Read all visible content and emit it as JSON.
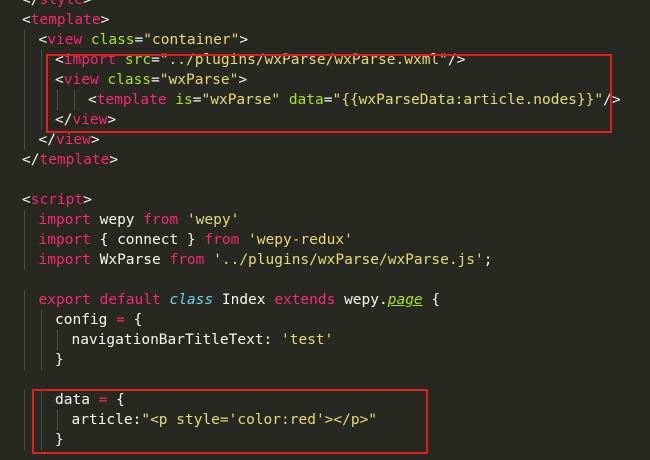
{
  "colors": {
    "background": "#272822",
    "default": "#f8f8f2",
    "tag": "#f92672",
    "attr": "#a6e22e",
    "string": "#e6db74",
    "keyword": "#f92672",
    "storage": "#66d9ef",
    "type": "#a6e22e",
    "annotation": "#e0201b",
    "guide": "#4a4a44"
  },
  "lines": [
    {
      "indent": 0,
      "tokens": [
        {
          "t": "</",
          "c": "default"
        },
        {
          "t": "style",
          "c": "tag"
        },
        {
          "t": ">",
          "c": "default"
        }
      ]
    },
    {
      "indent": 0,
      "tokens": [
        {
          "t": "<",
          "c": "default"
        },
        {
          "t": "template",
          "c": "tag"
        },
        {
          "t": ">",
          "c": "default"
        }
      ]
    },
    {
      "indent": 1,
      "tokens": [
        {
          "t": "<",
          "c": "default"
        },
        {
          "t": "view",
          "c": "tag"
        },
        {
          "t": " ",
          "c": "default"
        },
        {
          "t": "class",
          "c": "attr"
        },
        {
          "t": "=",
          "c": "default"
        },
        {
          "t": "\"container\"",
          "c": "string"
        },
        {
          "t": ">",
          "c": "default"
        }
      ]
    },
    {
      "indent": 2,
      "tokens": [
        {
          "t": "<",
          "c": "default"
        },
        {
          "t": "import",
          "c": "tag"
        },
        {
          "t": " ",
          "c": "default"
        },
        {
          "t": "src",
          "c": "attr"
        },
        {
          "t": "=",
          "c": "default"
        },
        {
          "t": "\"../plugins/wxParse/wxParse.wxml\"",
          "c": "string"
        },
        {
          "t": "/>",
          "c": "default"
        }
      ]
    },
    {
      "indent": 2,
      "tokens": [
        {
          "t": "<",
          "c": "default"
        },
        {
          "t": "view",
          "c": "tag"
        },
        {
          "t": " ",
          "c": "default"
        },
        {
          "t": "class",
          "c": "attr"
        },
        {
          "t": "=",
          "c": "default"
        },
        {
          "t": "\"wxParse\"",
          "c": "string"
        },
        {
          "t": ">",
          "c": "default"
        }
      ]
    },
    {
      "indent": 4,
      "tokens": [
        {
          "t": "<",
          "c": "default"
        },
        {
          "t": "template",
          "c": "tag"
        },
        {
          "t": " ",
          "c": "default"
        },
        {
          "t": "is",
          "c": "attr"
        },
        {
          "t": "=",
          "c": "default"
        },
        {
          "t": "\"wxParse\"",
          "c": "string"
        },
        {
          "t": " ",
          "c": "default"
        },
        {
          "t": "data",
          "c": "attr"
        },
        {
          "t": "=",
          "c": "default"
        },
        {
          "t": "\"{{wxParseData:article.nodes}}\"",
          "c": "string"
        },
        {
          "t": "/>",
          "c": "default"
        }
      ]
    },
    {
      "indent": 2,
      "tokens": [
        {
          "t": "</",
          "c": "default"
        },
        {
          "t": "view",
          "c": "tag"
        },
        {
          "t": ">",
          "c": "default"
        }
      ]
    },
    {
      "indent": 1,
      "tokens": [
        {
          "t": "</",
          "c": "default"
        },
        {
          "t": "view",
          "c": "tag"
        },
        {
          "t": ">",
          "c": "default"
        }
      ]
    },
    {
      "indent": 0,
      "tokens": [
        {
          "t": "</",
          "c": "default"
        },
        {
          "t": "template",
          "c": "tag"
        },
        {
          "t": ">",
          "c": "default"
        }
      ]
    },
    {
      "indent": 0,
      "tokens": []
    },
    {
      "indent": 0,
      "tokens": [
        {
          "t": "<",
          "c": "default"
        },
        {
          "t": "script",
          "c": "tag"
        },
        {
          "t": ">",
          "c": "default"
        }
      ]
    },
    {
      "indent": 1,
      "tokens": [
        {
          "t": "import",
          "c": "keyword"
        },
        {
          "t": " wepy ",
          "c": "default"
        },
        {
          "t": "from",
          "c": "keyword"
        },
        {
          "t": " ",
          "c": "default"
        },
        {
          "t": "'wepy'",
          "c": "string"
        }
      ]
    },
    {
      "indent": 1,
      "tokens": [
        {
          "t": "import",
          "c": "keyword"
        },
        {
          "t": " { connect } ",
          "c": "default"
        },
        {
          "t": "from",
          "c": "keyword"
        },
        {
          "t": " ",
          "c": "default"
        },
        {
          "t": "'wepy-redux'",
          "c": "string"
        }
      ]
    },
    {
      "indent": 1,
      "tokens": [
        {
          "t": "import",
          "c": "keyword"
        },
        {
          "t": " WxParse ",
          "c": "default"
        },
        {
          "t": "from",
          "c": "keyword"
        },
        {
          "t": " ",
          "c": "default"
        },
        {
          "t": "'../plugins/wxParse/wxParse.js'",
          "c": "string"
        },
        {
          "t": ";",
          "c": "default"
        }
      ]
    },
    {
      "indent": 0,
      "tokens": []
    },
    {
      "indent": 1,
      "tokens": [
        {
          "t": "export",
          "c": "keyword"
        },
        {
          "t": " ",
          "c": "default"
        },
        {
          "t": "default",
          "c": "keyword"
        },
        {
          "t": " ",
          "c": "default"
        },
        {
          "t": "class",
          "c": "storage",
          "italic": true
        },
        {
          "t": " Index ",
          "c": "default"
        },
        {
          "t": "extends",
          "c": "keyword"
        },
        {
          "t": " wepy.",
          "c": "default"
        },
        {
          "t": "page",
          "c": "type",
          "italic": true,
          "underline": true
        },
        {
          "t": " {",
          "c": "default"
        }
      ]
    },
    {
      "indent": 2,
      "tokens": [
        {
          "t": "config",
          "c": "default"
        },
        {
          "t": " = ",
          "c": "keyword"
        },
        {
          "t": "{",
          "c": "default"
        }
      ]
    },
    {
      "indent": 3,
      "tokens": [
        {
          "t": "navigationBarTitleText: ",
          "c": "default"
        },
        {
          "t": "'test'",
          "c": "string"
        }
      ]
    },
    {
      "indent": 2,
      "tokens": [
        {
          "t": "}",
          "c": "default"
        }
      ]
    },
    {
      "indent": 0,
      "tokens": []
    },
    {
      "indent": 2,
      "tokens": [
        {
          "t": "data",
          "c": "default"
        },
        {
          "t": " = ",
          "c": "keyword"
        },
        {
          "t": "{",
          "c": "default"
        }
      ]
    },
    {
      "indent": 3,
      "tokens": [
        {
          "t": "article:",
          "c": "default"
        },
        {
          "t": "\"<p style='color:red'></p>\"",
          "c": "string"
        }
      ]
    },
    {
      "indent": 2,
      "tokens": [
        {
          "t": "}",
          "c": "default"
        }
      ]
    }
  ]
}
